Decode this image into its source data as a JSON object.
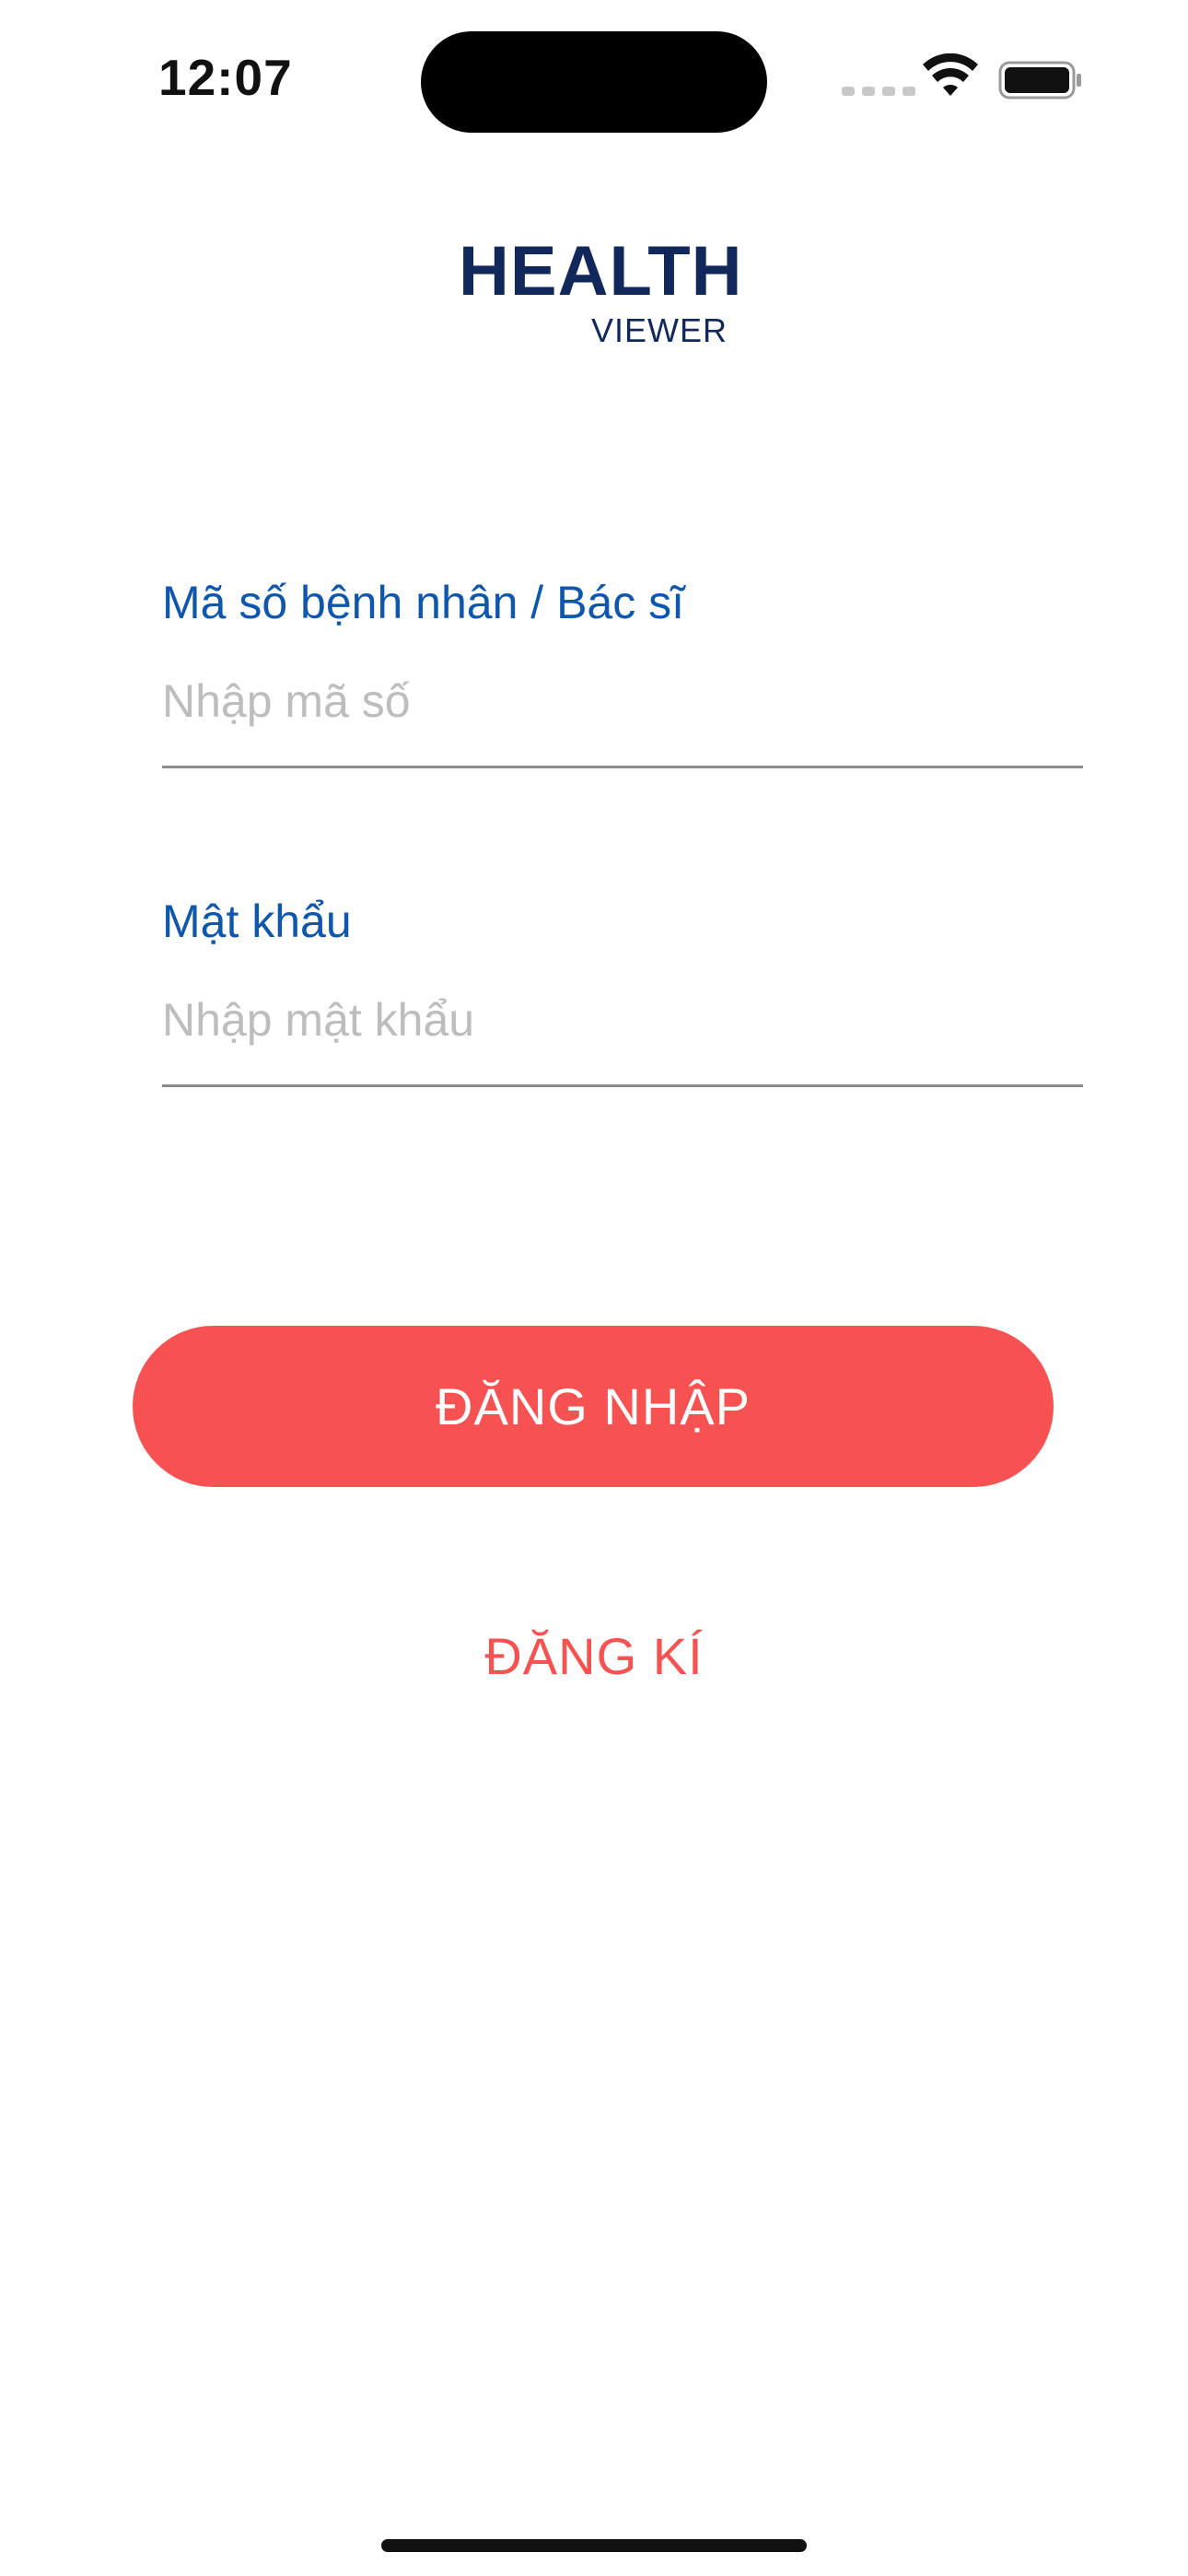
{
  "status_bar": {
    "time": "12:07",
    "icons": [
      "cellular-signal-icon",
      "wifi-icon",
      "battery-icon"
    ]
  },
  "logo": {
    "main": "HEALTH",
    "sub": "VIEWER"
  },
  "form": {
    "id_field": {
      "label": "Mã số bệnh nhân / Bác sĩ",
      "placeholder": "Nhập mã số",
      "value": ""
    },
    "password_field": {
      "label": "Mật khẩu",
      "placeholder": "Nhập mật khẩu",
      "value": ""
    }
  },
  "actions": {
    "login_label": "ĐĂNG NHẬP",
    "register_label": "ĐĂNG KÍ"
  },
  "colors": {
    "brand_navy": "#13285a",
    "label_blue": "#0f56ad",
    "accent_red": "#f75252"
  }
}
